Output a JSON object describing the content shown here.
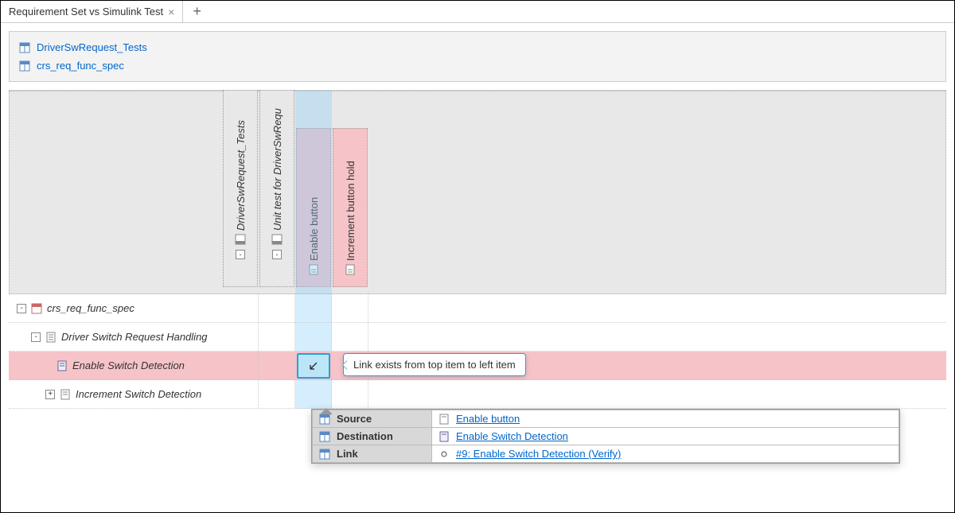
{
  "tabs": {
    "active": "Requirement Set vs Simulink Test",
    "add": "+"
  },
  "files": [
    {
      "name": "DriverSwRequest_Tests"
    },
    {
      "name": "crs_req_func_spec"
    }
  ],
  "columns": [
    {
      "label": "DriverSwRequest_Tests",
      "expandable": true
    },
    {
      "label": "Unit test for DriverSwRequ",
      "expandable": true
    },
    {
      "label": "Enable button",
      "expandable": false,
      "pink": true
    },
    {
      "label": "Increment button hold",
      "expandable": false,
      "pink": true
    }
  ],
  "rows": [
    {
      "label": "crs_req_func_spec",
      "indent": 0,
      "exp": "-"
    },
    {
      "label": "Driver Switch Request Handling",
      "indent": 1,
      "exp": "-"
    },
    {
      "label": "Enable Switch Detection",
      "indent": 2,
      "highlight": true
    },
    {
      "label": "Increment Switch Detection",
      "indent": 2,
      "exp": "+"
    }
  ],
  "tooltip": "Link exists from top item to left item",
  "details": {
    "source_key": "Source",
    "source_val": "Enable button",
    "dest_key": "Destination",
    "dest_val": "Enable Switch Detection",
    "link_key": "Link",
    "link_val": "#9: Enable Switch Detection (Verify)"
  }
}
